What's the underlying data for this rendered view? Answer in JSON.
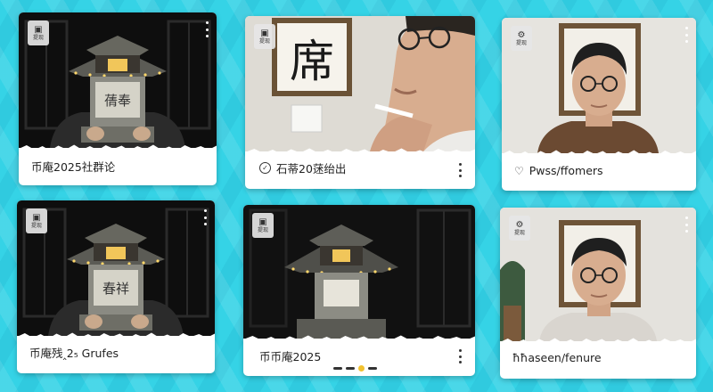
{
  "cards": [
    {
      "badge": {
        "icon": "user-square-icon",
        "glyph": "▣",
        "label": "提现"
      },
      "caption": "币庵2025社群论",
      "caption_icon": "",
      "caption_glyph": ""
    },
    {
      "badge": {
        "icon": "user-square-icon",
        "glyph": "▣",
        "label": "提现"
      },
      "caption": "石蒂20蒁绐出",
      "caption_icon": "check-circle-icon",
      "caption_glyph": "✓"
    },
    {
      "badge": {
        "icon": "gear-icon",
        "glyph": "⚙",
        "label": "提现"
      },
      "caption": "Pwss/ffomers",
      "caption_icon": "heart-icon",
      "caption_glyph": "♡"
    },
    {
      "badge": {
        "icon": "user-square-icon",
        "glyph": "▣",
        "label": "提现"
      },
      "caption": "币庵残‸2₅ Grufes",
      "caption_icon": "",
      "caption_glyph": ""
    },
    {
      "badge": {
        "icon": "user-square-icon",
        "glyph": "▣",
        "label": "提现"
      },
      "caption": "币币庵2025",
      "caption_icon": "",
      "caption_glyph": ""
    },
    {
      "badge": {
        "icon": "gear-icon",
        "glyph": "⚙",
        "label": "提现"
      },
      "caption": "ħħaseen/fenure",
      "caption_icon": "",
      "caption_glyph": ""
    }
  ],
  "images": {
    "lantern_plaque_1": "蒨奉",
    "lantern_plaque_2": "春祥",
    "calligraphy": "席"
  },
  "colors": {
    "background": "#35d3e6",
    "card": "#ffffff",
    "accent_dot": "#f2c230"
  }
}
